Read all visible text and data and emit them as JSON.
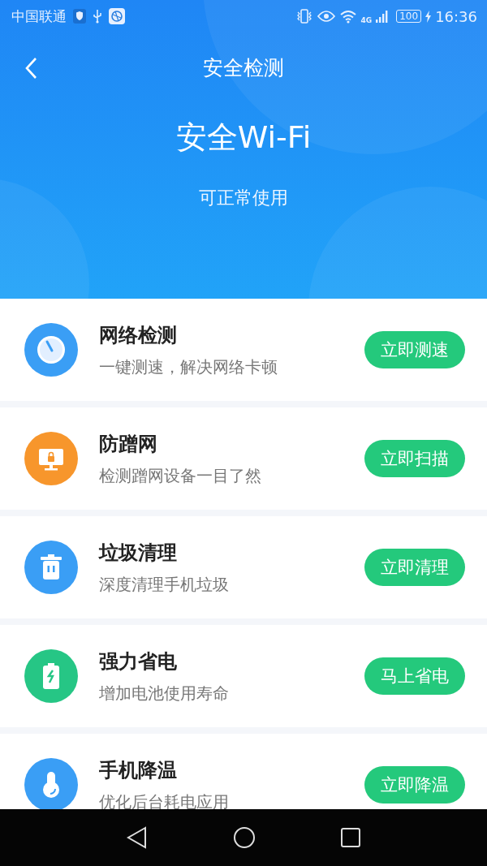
{
  "status_bar": {
    "carrier": "中国联通",
    "network": "4G",
    "battery": "100",
    "time": "16:36"
  },
  "header": {
    "title": "安全检测"
  },
  "hero": {
    "title": "安全Wi-Fi",
    "subtitle": "可正常使用"
  },
  "features": [
    {
      "kind": "gauge",
      "color": "#3a9ef5",
      "title": "网络检测",
      "description": "一键测速，解决网络卡顿",
      "action": "立即测速"
    },
    {
      "kind": "monitor",
      "color": "#f7962c",
      "title": "防蹭网",
      "description": "检测蹭网设备一目了然",
      "action": "立即扫描"
    },
    {
      "kind": "trash",
      "color": "#3a9ef5",
      "title": "垃圾清理",
      "description": "深度清理手机垃圾",
      "action": "立即清理"
    },
    {
      "kind": "battery",
      "color": "#26c685",
      "title": "强力省电",
      "description": "增加电池使用寿命",
      "action": "马上省电"
    },
    {
      "kind": "thermometer",
      "color": "#3a9ef5",
      "title": "手机降温",
      "description": "优化后台耗电应用",
      "action": "立即降温"
    }
  ]
}
